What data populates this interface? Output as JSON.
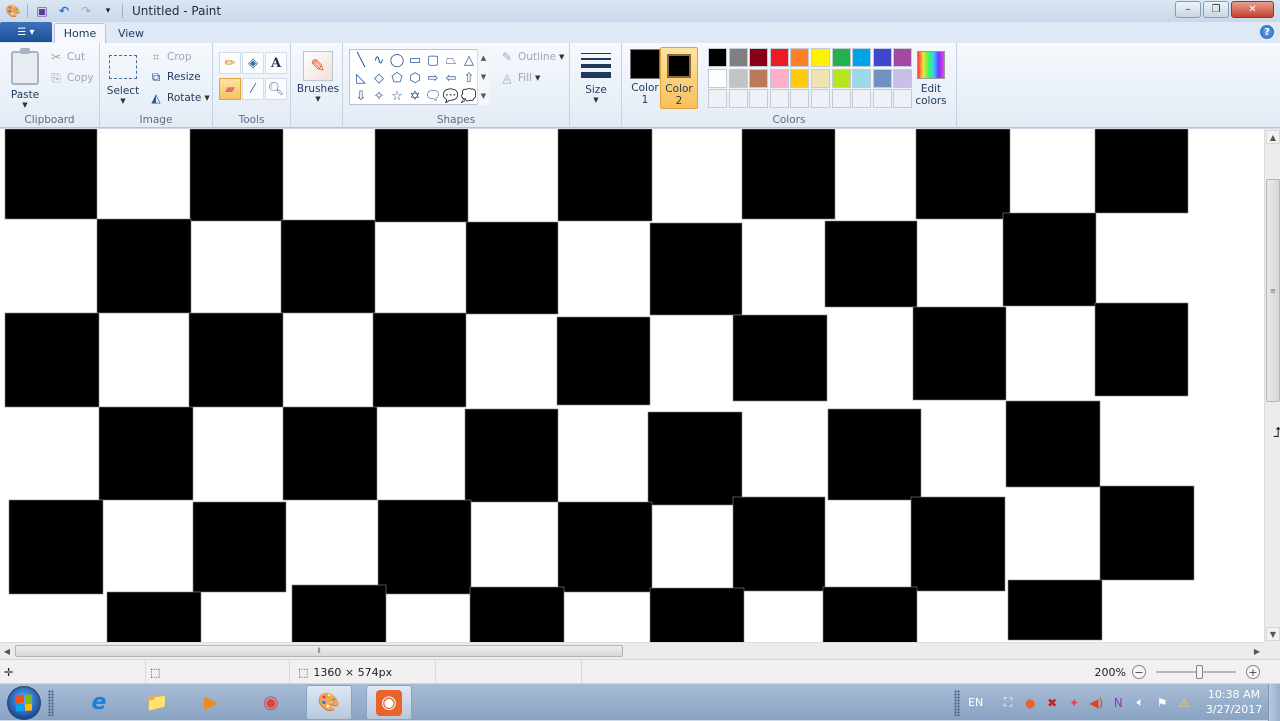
{
  "window": {
    "title": "Untitled - Paint",
    "controls": {
      "minimize": "–",
      "restore": "❐",
      "close": "✕"
    }
  },
  "quick_access": [
    {
      "name": "paint-app-icon",
      "glyph": "🎨"
    },
    {
      "name": "save-icon",
      "glyph": "💾"
    },
    {
      "name": "undo-icon",
      "glyph": "↶"
    },
    {
      "name": "redo-icon",
      "glyph": "↷"
    },
    {
      "name": "customize-qat-icon",
      "glyph": "▾"
    }
  ],
  "tabs": {
    "file_glyph": "☰ ▾",
    "items": [
      {
        "label": "Home",
        "active": true
      },
      {
        "label": "View",
        "active": false
      }
    ],
    "help_glyph": "?"
  },
  "ribbon": {
    "clipboard": {
      "label": "Clipboard",
      "paste": "Paste",
      "cut": "Cut",
      "copy": "Copy"
    },
    "image": {
      "label": "Image",
      "select": "Select",
      "crop": "Crop",
      "resize": "Resize",
      "rotate": "Rotate"
    },
    "tools": {
      "label": "Tools",
      "items": [
        {
          "name": "pencil",
          "glyph": "✏",
          "active": false
        },
        {
          "name": "fill",
          "glyph": "🪣",
          "active": false
        },
        {
          "name": "text",
          "glyph": "A",
          "active": false
        },
        {
          "name": "eraser",
          "glyph": "▱",
          "active": true
        },
        {
          "name": "color-picker",
          "glyph": "💧",
          "active": false
        },
        {
          "name": "magnifier",
          "glyph": "🔍",
          "active": false
        }
      ]
    },
    "brushes": {
      "label": "Brushes"
    },
    "shapes": {
      "label": "Shapes",
      "items": [
        "╲",
        "∿",
        "◯",
        "▭",
        "▢",
        "⏢",
        "△",
        "◺",
        "◇",
        "⬠",
        "⬡",
        "⇨",
        "⇦",
        "⇧",
        "⇩",
        "✧",
        "☆",
        "✡",
        "🗨",
        "💬",
        "💭"
      ],
      "outline": "Outline",
      "fill": "Fill"
    },
    "size": {
      "label": "Size"
    },
    "colors": {
      "label": "Colors",
      "color1_label": "Color\n1",
      "color1_l1": "Color",
      "color1_l2": "1",
      "color2_l1": "Color",
      "color2_l2": "2",
      "color1": "#000000",
      "color2": "#000000",
      "active": "color2",
      "palette_row1": [
        "#000000",
        "#7f7f7f",
        "#880015",
        "#ed1c24",
        "#ff7f27",
        "#fff200",
        "#22b14c",
        "#00a2e8",
        "#3f48cc",
        "#a349a4"
      ],
      "palette_row2": [
        "#ffffff",
        "#c3c3c3",
        "#b97a57",
        "#ffaec9",
        "#ffc90e",
        "#efe4b0",
        "#b5e61d",
        "#99d9ea",
        "#7092be",
        "#c8bfe7"
      ],
      "palette_row3_empty": 10,
      "edit_l1": "Edit",
      "edit_l2": "colors"
    }
  },
  "canvas": {
    "image_size": "1360 × 574px",
    "background": "#ffffff",
    "pattern": "hand-drawn black and white checkerboard",
    "square_color": "#000000"
  },
  "statusbar": {
    "position_glyph": "✛",
    "selection_glyph": "⬚",
    "size_glyph": "⬚",
    "image_size": "1360 × 574px",
    "zoom": "200%",
    "zoom_level_percent": 200
  },
  "taskbar": {
    "apps": [
      {
        "name": "internet-explorer",
        "glyph": "e",
        "color": "#1e7fd6",
        "open": false
      },
      {
        "name": "file-explorer",
        "glyph": "📁",
        "color": "#f2c24f",
        "open": false
      },
      {
        "name": "media-player",
        "glyph": "▶",
        "color": "#f08a1c",
        "open": false
      },
      {
        "name": "chrome",
        "glyph": "◉",
        "color": "#db4437",
        "open": false
      },
      {
        "name": "paint",
        "glyph": "🎨",
        "color": "#c9d7e8",
        "open": true
      },
      {
        "name": "screen-recorder",
        "glyph": "◉",
        "color": "#e8642b",
        "open": true
      }
    ],
    "tray": {
      "language": "EN",
      "icons": [
        "screen-capture",
        "recorder-stop",
        "antivirus",
        "network-tool",
        "volume-red",
        "onenote",
        "speaker",
        "action-center-flag",
        "network-warning"
      ]
    },
    "clock": {
      "time": "10:38 AM",
      "date": "3/27/2017"
    }
  }
}
